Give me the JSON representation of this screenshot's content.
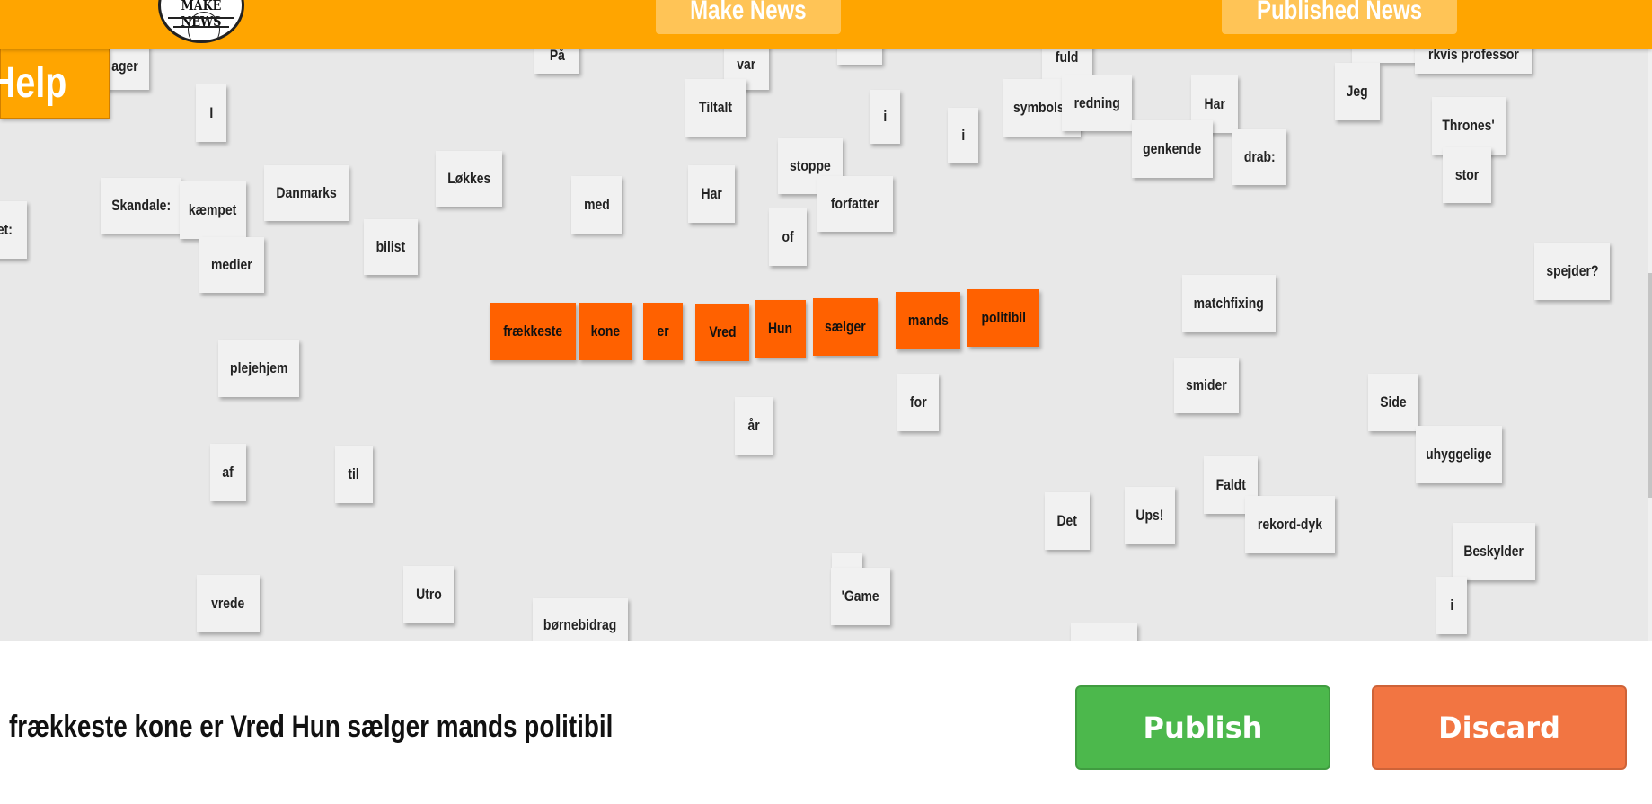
{
  "header": {
    "logo_text": "MAKE NEWS",
    "nav": [
      {
        "label": "Make News"
      },
      {
        "label": "Published News"
      }
    ],
    "help_label": "Help"
  },
  "board": {
    "words": [
      "ager",
      "På",
      "var",
      "fuld",
      "rkvis professor",
      "I",
      "Tiltalt",
      "i",
      "i",
      "symbolsk",
      "redning",
      "Har",
      "Jeg",
      "Thrones'",
      "genkende",
      "drab:",
      "stor",
      "stoppe",
      "Skandale:",
      "kæmpet",
      "Danmarks",
      "Løkkes",
      "med",
      "Har",
      "forfatter",
      "of",
      "medier",
      "bilist",
      "spejder?",
      "matchfixing",
      "plejehjem",
      "for",
      "smider",
      "år",
      "Side",
      "uhyggelige",
      "af",
      "til",
      "Faldt",
      "Det",
      "Ups!",
      "rekord-dyk",
      "Beskylder",
      "vrede",
      "Utro",
      "'Game",
      "i",
      "børnebidrag",
      "et:"
    ],
    "selected_words": [
      "frækkeste",
      "kone",
      "er",
      "Vred",
      "Hun",
      "sælger",
      "mands",
      "politibil"
    ]
  },
  "composer": {
    "headline": "frækkeste kone er Vred Hun sælger mands politibil",
    "publish_label": "Publish",
    "discard_label": "Discard"
  },
  "colors": {
    "header": "#ffa500",
    "selected_tile": "#ff6100",
    "publish": "#4cb84c",
    "discard": "#f27542"
  }
}
